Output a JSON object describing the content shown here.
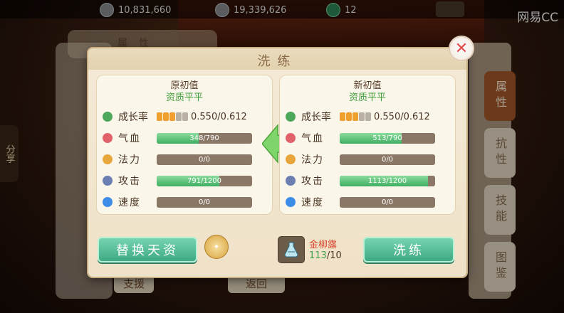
{
  "topbar": {
    "silver": "10,831,660",
    "coin": "19,339,626",
    "jade": "12",
    "watermark": "网易CC"
  },
  "background": {
    "left_tab_title": "属性",
    "share_label": "分享",
    "support_label": "支援",
    "return_label": "返回",
    "side_tabs": [
      {
        "label": "属性",
        "active": true
      },
      {
        "label": "抗性",
        "active": false
      },
      {
        "label": "技能",
        "active": false
      },
      {
        "label": "图鉴",
        "active": false
      }
    ]
  },
  "dialog": {
    "title": "洗练",
    "left": {
      "title": "原初值",
      "quality": "资质平平",
      "growth": {
        "label": "成长率",
        "value": "0.550/0.612",
        "stars_on": 3,
        "stars_total": 5
      },
      "stats": [
        {
          "label": "气血",
          "text": "348/790",
          "value": 348,
          "max": 790,
          "icon": "heart-icon",
          "cls": "hp"
        },
        {
          "label": "法力",
          "text": "0/0",
          "value": 0,
          "max": 0,
          "icon": "mana-icon",
          "cls": "mp"
        },
        {
          "label": "攻击",
          "text": "791/1200",
          "value": 791,
          "max": 1200,
          "icon": "sword-icon",
          "cls": "atk"
        },
        {
          "label": "速度",
          "text": "0/0",
          "value": 0,
          "max": 0,
          "icon": "speed-icon",
          "cls": "spd"
        }
      ]
    },
    "right": {
      "title": "新初值",
      "quality": "资质平平",
      "growth": {
        "label": "成长率",
        "value": "0.550/0.612",
        "stars_on": 3,
        "stars_total": 5
      },
      "stats": [
        {
          "label": "气血",
          "text": "513/790",
          "value": 513,
          "max": 790,
          "icon": "heart-icon",
          "cls": "hp"
        },
        {
          "label": "法力",
          "text": "0/0",
          "value": 0,
          "max": 0,
          "icon": "mana-icon",
          "cls": "mp"
        },
        {
          "label": "攻击",
          "text": "1113/1200",
          "value": 1113,
          "max": 1200,
          "icon": "sword-icon",
          "cls": "atk"
        },
        {
          "label": "速度",
          "text": "0/0",
          "value": 0,
          "max": 0,
          "icon": "speed-icon",
          "cls": "spd"
        }
      ]
    },
    "replace_button": "替换天资",
    "wash_button": "洗练",
    "item": {
      "name": "金柳露",
      "owned": "113",
      "cost": "10"
    },
    "badge_icon": "medal-icon"
  },
  "colors": {
    "accent_green": "#3fae63",
    "quality_green": "#3e9b3a",
    "item_red": "#d9462f"
  }
}
